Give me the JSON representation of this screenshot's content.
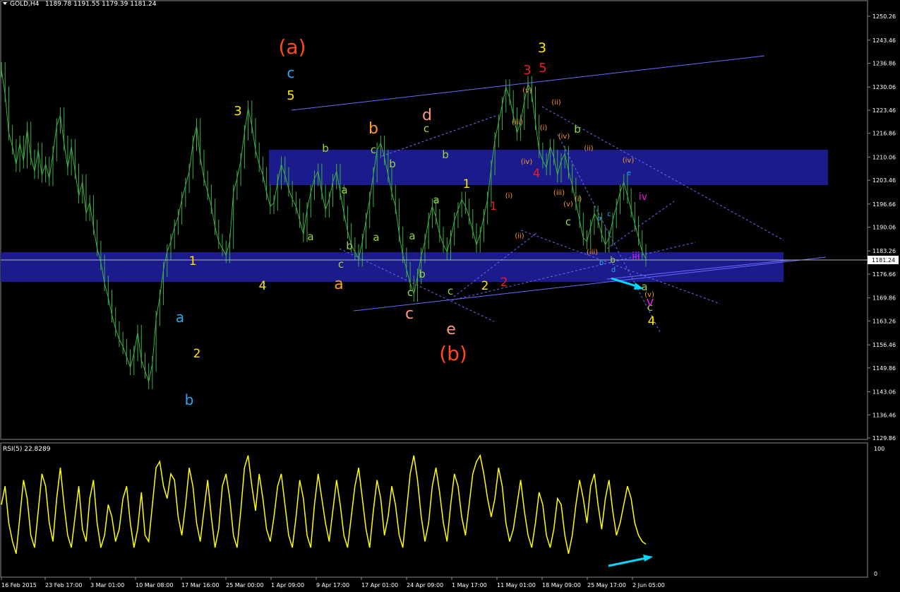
{
  "header": {
    "symbol_label": "GOLD,H4",
    "ohlc": "1189.78 1191.55 1179.39 1181.24",
    "current_price": "1181.24"
  },
  "indicator": {
    "label": "RSI(5) 22.8289",
    "scale_top": "100",
    "scale_bottom": "0"
  },
  "colors": {
    "background": "#000000",
    "candles": "#3cb043",
    "zone": "#1b1b8c",
    "channel": "#6a6aff",
    "rsi": "#ffff00",
    "arrow": "#00d8ff"
  },
  "chart_data": {
    "type": "line",
    "ylim": [
      1129.86,
      1253.5
    ],
    "y_ticks": [
      "1250.26",
      "1243.46",
      "1236.86",
      "1230.06",
      "1223.46",
      "1216.86",
      "1210.06",
      "1203.46",
      "1196.66",
      "1190.06",
      "1183.26",
      "1176.66",
      "1169.86",
      "1163.26",
      "1156.46",
      "1149.86",
      "1143.06",
      "1136.46",
      "1129.86"
    ],
    "x_ticks": [
      "16 Feb 2015",
      "23 Feb 17:00",
      "3 Mar 01:00",
      "10 Mar 08:00",
      "17 Mar 16:00",
      "25 Mar 00:00",
      "1 Apr 09:00",
      "9 Apr 17:00",
      "17 Apr 01:00",
      "24 Apr 09:00",
      "1 May 17:00",
      "11 May 01:00",
      "18 May 09:00",
      "25 May 17:00",
      "2 Jun 05:00"
    ],
    "series": [
      {
        "values": [
          1235,
          1228,
          1217,
          1213,
          1208,
          1214,
          1209,
          1218,
          1210,
          1206,
          1212,
          1205,
          1208,
          1204,
          1211,
          1219,
          1222,
          1214,
          1207,
          1213,
          1206,
          1199,
          1203,
          1194,
          1197,
          1190,
          1184,
          1180,
          1174,
          1170,
          1165,
          1161,
          1158,
          1156,
          1153,
          1150,
          1154,
          1160,
          1152,
          1149,
          1146,
          1151,
          1164,
          1170,
          1178,
          1183,
          1186,
          1190,
          1193,
          1198,
          1202,
          1206,
          1214,
          1219,
          1210,
          1204,
          1200,
          1196,
          1190,
          1186,
          1184,
          1182,
          1186,
          1200,
          1204,
          1209,
          1217,
          1224,
          1219,
          1212,
          1208,
          1205,
          1200,
          1196,
          1197,
          1203,
          1208,
          1205,
          1201,
          1198,
          1196,
          1192,
          1188,
          1195,
          1200,
          1204,
          1206,
          1200,
          1195,
          1198,
          1203,
          1206,
          1200,
          1194,
          1189,
          1185,
          1183,
          1181,
          1186,
          1192,
          1198,
          1205,
          1212,
          1214,
          1210,
          1205,
          1200,
          1196,
          1188,
          1182,
          1178,
          1174,
          1171,
          1176,
          1182,
          1186,
          1192,
          1196,
          1193,
          1188,
          1185,
          1183,
          1187,
          1192,
          1195,
          1198,
          1196,
          1193,
          1189,
          1185,
          1188,
          1193,
          1198,
          1207,
          1215,
          1220,
          1225,
          1230,
          1227,
          1222,
          1217,
          1220,
          1226,
          1231,
          1228,
          1220,
          1212,
          1209,
          1207,
          1213,
          1210,
          1205,
          1209,
          1211,
          1206,
          1202,
          1197,
          1192,
          1187,
          1186,
          1190,
          1194,
          1192,
          1188,
          1185,
          1187,
          1192,
          1196,
          1200,
          1203,
          1199,
          1195,
          1191,
          1187,
          1183,
          1181
        ]
      },
      {
        "name": "RSI(5)",
        "values": [
          55,
          70,
          40,
          25,
          15,
          45,
          75,
          60,
          30,
          20,
          50,
          80,
          70,
          40,
          25,
          60,
          85,
          55,
          30,
          20,
          45,
          70,
          35,
          25,
          60,
          75,
          40,
          20,
          30,
          55,
          45,
          25,
          35,
          60,
          70,
          40,
          20,
          35,
          65,
          30,
          25,
          55,
          85,
          90,
          70,
          60,
          80,
          75,
          45,
          30,
          55,
          85,
          70,
          40,
          25,
          50,
          75,
          45,
          20,
          35,
          70,
          80,
          60,
          30,
          20,
          50,
          85,
          95,
          70,
          50,
          80,
          60,
          35,
          25,
          45,
          70,
          80,
          55,
          30,
          20,
          45,
          75,
          60,
          30,
          20,
          55,
          80,
          60,
          40,
          25,
          50,
          75,
          55,
          30,
          20,
          45,
          70,
          85,
          60,
          35,
          20,
          50,
          75,
          60,
          30,
          45,
          70,
          55,
          30,
          20,
          50,
          80,
          95,
          75,
          45,
          25,
          40,
          70,
          85,
          65,
          40,
          25,
          55,
          80,
          70,
          45,
          30,
          55,
          80,
          90,
          95,
          80,
          60,
          45,
          60,
          85,
          70,
          40,
          25,
          35,
          55,
          75,
          50,
          30,
          20,
          40,
          65,
          55,
          30,
          20,
          35,
          60,
          55,
          30,
          15,
          30,
          55,
          75,
          60,
          40,
          70,
          80,
          55,
          35,
          60,
          75,
          50,
          30,
          40,
          55,
          70,
          60,
          40,
          30,
          25,
          22.8289
        ]
      }
    ],
    "annotations": [
      {
        "text": "(a)",
        "color": "#ff4a1c"
      },
      {
        "text": "(b)",
        "color": "#ff4a1c"
      },
      {
        "text": "c",
        "color": "#29a9f0"
      },
      {
        "text": "5",
        "color": "#ffe600"
      },
      {
        "text": "3",
        "color": "#ffe600"
      },
      {
        "text": "1",
        "color": "#ffe600"
      },
      {
        "text": "2",
        "color": "#ffe600"
      },
      {
        "text": "4",
        "color": "#ffe600"
      },
      {
        "text": "a",
        "color": "#29a9f0"
      },
      {
        "text": "b",
        "color": "#29a9f0"
      },
      {
        "text": "b",
        "color": "#ff9a1c"
      },
      {
        "text": "a",
        "color": "#ff9a1c"
      },
      {
        "text": "c",
        "color": "#ff9a7c"
      },
      {
        "text": "d",
        "color": "#ff9a7c"
      },
      {
        "text": "e",
        "color": "#ff9a7c"
      },
      {
        "text": "b",
        "color": "#9ad63c"
      },
      {
        "text": "a",
        "color": "#9ad63c"
      },
      {
        "text": "a",
        "color": "#9ad63c"
      },
      {
        "text": "b",
        "color": "#9ad63c"
      },
      {
        "text": "c",
        "color": "#9ad63c"
      },
      {
        "text": "c",
        "color": "#9ad63c"
      },
      {
        "text": "b",
        "color": "#9ad63c"
      },
      {
        "text": "a",
        "color": "#9ad63c"
      },
      {
        "text": "a",
        "color": "#9ad63c"
      },
      {
        "text": "c",
        "color": "#9ad63c"
      },
      {
        "text": "b",
        "color": "#9ad63c"
      },
      {
        "text": "c",
        "color": "#9ad63c"
      },
      {
        "text": "b",
        "color": "#9ad63c"
      },
      {
        "text": "a",
        "color": "#9ad63c"
      },
      {
        "text": "c",
        "color": "#9ad63c"
      },
      {
        "text": "b",
        "color": "#9ad63c"
      },
      {
        "text": "c",
        "color": "#9ad63c"
      },
      {
        "text": "a",
        "color": "#9ad63c"
      },
      {
        "text": "b",
        "color": "#9ad63c"
      },
      {
        "text": "c",
        "color": "#9ad63c"
      },
      {
        "text": "1",
        "color": "#ffe600"
      },
      {
        "text": "2",
        "color": "#ffe600"
      },
      {
        "text": "3",
        "color": "#ffe600"
      },
      {
        "text": "4",
        "color": "#ffe600"
      },
      {
        "text": "1",
        "color": "#ee1c1c"
      },
      {
        "text": "2",
        "color": "#ee1c1c"
      },
      {
        "text": "3",
        "color": "#ee1c1c"
      },
      {
        "text": "4",
        "color": "#ee1c1c"
      },
      {
        "text": "5",
        "color": "#ee1c1c"
      },
      {
        "text": "(i)",
        "color": "#ff9a1c"
      },
      {
        "text": "(ii)",
        "color": "#ff9a1c"
      },
      {
        "text": "(iii)",
        "color": "#ff9a1c"
      },
      {
        "text": "(iv)",
        "color": "#ff9a1c"
      },
      {
        "text": "(v)",
        "color": "#ff9a1c"
      },
      {
        "text": "(i)",
        "color": "#ff9a1c"
      },
      {
        "text": "(ii)",
        "color": "#ff9a1c"
      },
      {
        "text": "(iii)",
        "color": "#ff9a1c"
      },
      {
        "text": "(iv)",
        "color": "#ff9a1c"
      },
      {
        "text": "(v)",
        "color": "#ff9a1c"
      },
      {
        "text": "(i)",
        "color": "#ff9a1c"
      },
      {
        "text": "(ii)",
        "color": "#ff9a1c"
      },
      {
        "text": "(iii)",
        "color": "#ff9a1c"
      },
      {
        "text": "(iv)",
        "color": "#ff9a1c"
      },
      {
        "text": "(v)",
        "color": "#ff9a1c"
      },
      {
        "text": "a",
        "color": "#29a9f0"
      },
      {
        "text": "b",
        "color": "#29a9f0"
      },
      {
        "text": "c",
        "color": "#29a9f0"
      },
      {
        "text": "d",
        "color": "#29a9f0"
      },
      {
        "text": "e",
        "color": "#29a9f0"
      },
      {
        "text": "iii",
        "color": "#e020e0"
      },
      {
        "text": "iv",
        "color": "#e020e0"
      },
      {
        "text": "v",
        "color": "#e020e0"
      }
    ]
  }
}
